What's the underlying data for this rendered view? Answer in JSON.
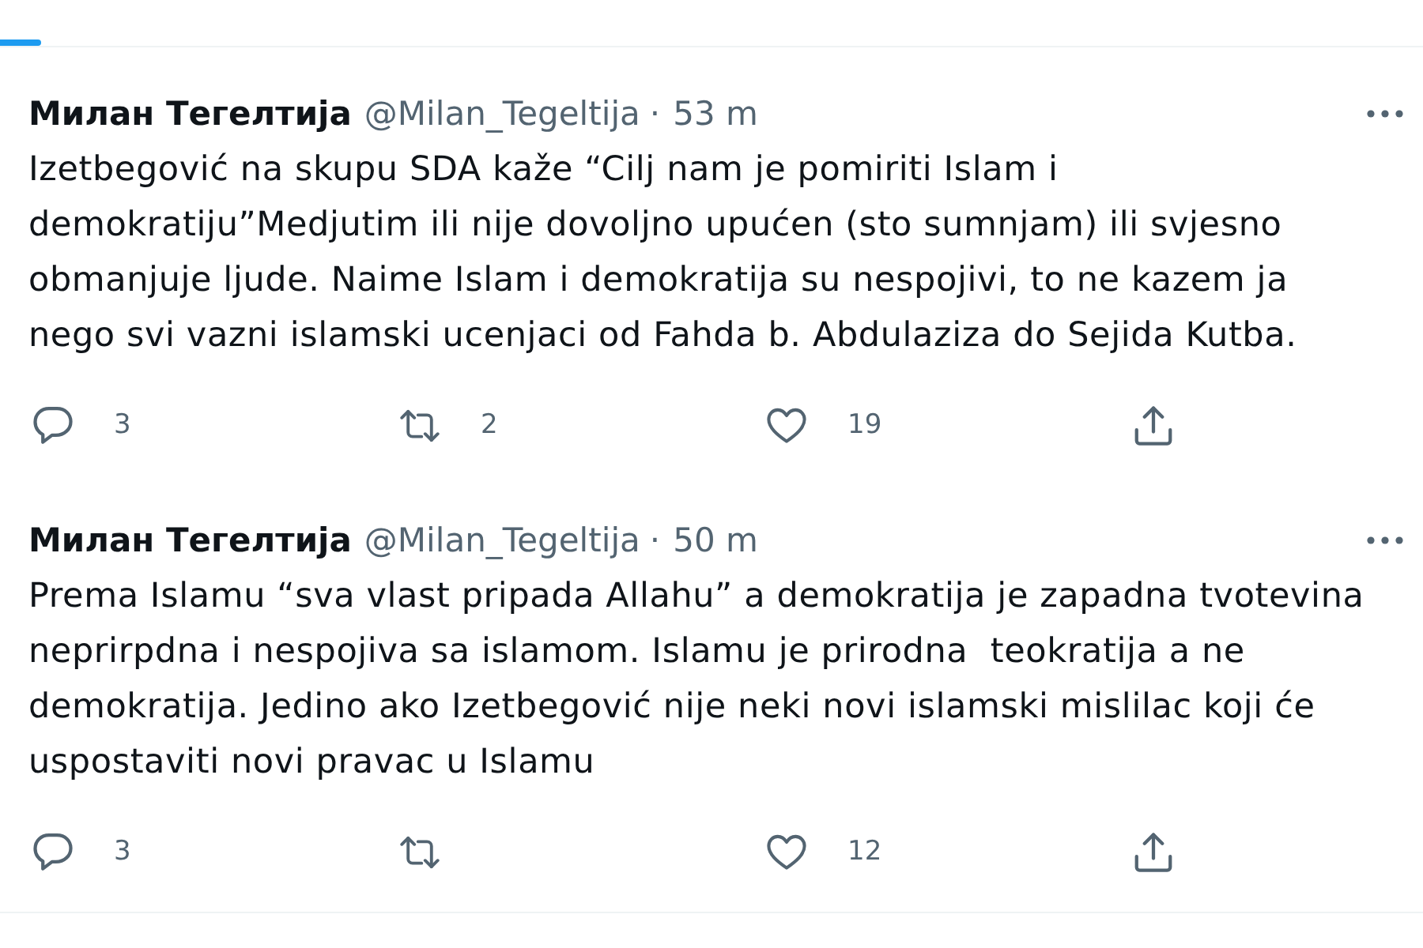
{
  "tweets": [
    {
      "name": "Милан Тегелтија",
      "handle": "@Milan_Tegeltija",
      "separator": "·",
      "time": "53 m",
      "text": "Izetbegović na skupu SDA kaže “Cilj nam je pomiriti Islam i\ndemokratiju”Medjutim ili nije dovoljno upućen (sto sumnjam) ili svjesno\nobmanjuje ljude. Naime Islam i demokratija su nespojivi, to ne kazem ja\nnego svi vazni islamski ucenjaci od Fahda b. Abdulaziza do Sejida Kutba.",
      "actions": [
        {
          "kind": "reply",
          "count": "3"
        },
        {
          "kind": "retweet",
          "count": "2"
        },
        {
          "kind": "like",
          "count": "19"
        },
        {
          "kind": "share"
        }
      ]
    },
    {
      "name": "Милан Тегелтија",
      "handle": "@Milan_Tegeltija",
      "separator": "·",
      "time": "50 m",
      "text": "Prema Islamu “sva vlast pripada Allahu” a demokratija je zapadna tvotevina\nneprirpdna i nespojiva sa islamom. Islamu je prirodna  teokratija a ne\ndemokratija. Jedino ako Izetbegović nije neki novi islamski mislilac koji će\nuspostaviti novi pravac u Islamu",
      "actions": [
        {
          "kind": "reply",
          "count": "3"
        },
        {
          "kind": "retweet"
        },
        {
          "kind": "like",
          "count": "12"
        },
        {
          "kind": "share"
        }
      ]
    }
  ]
}
